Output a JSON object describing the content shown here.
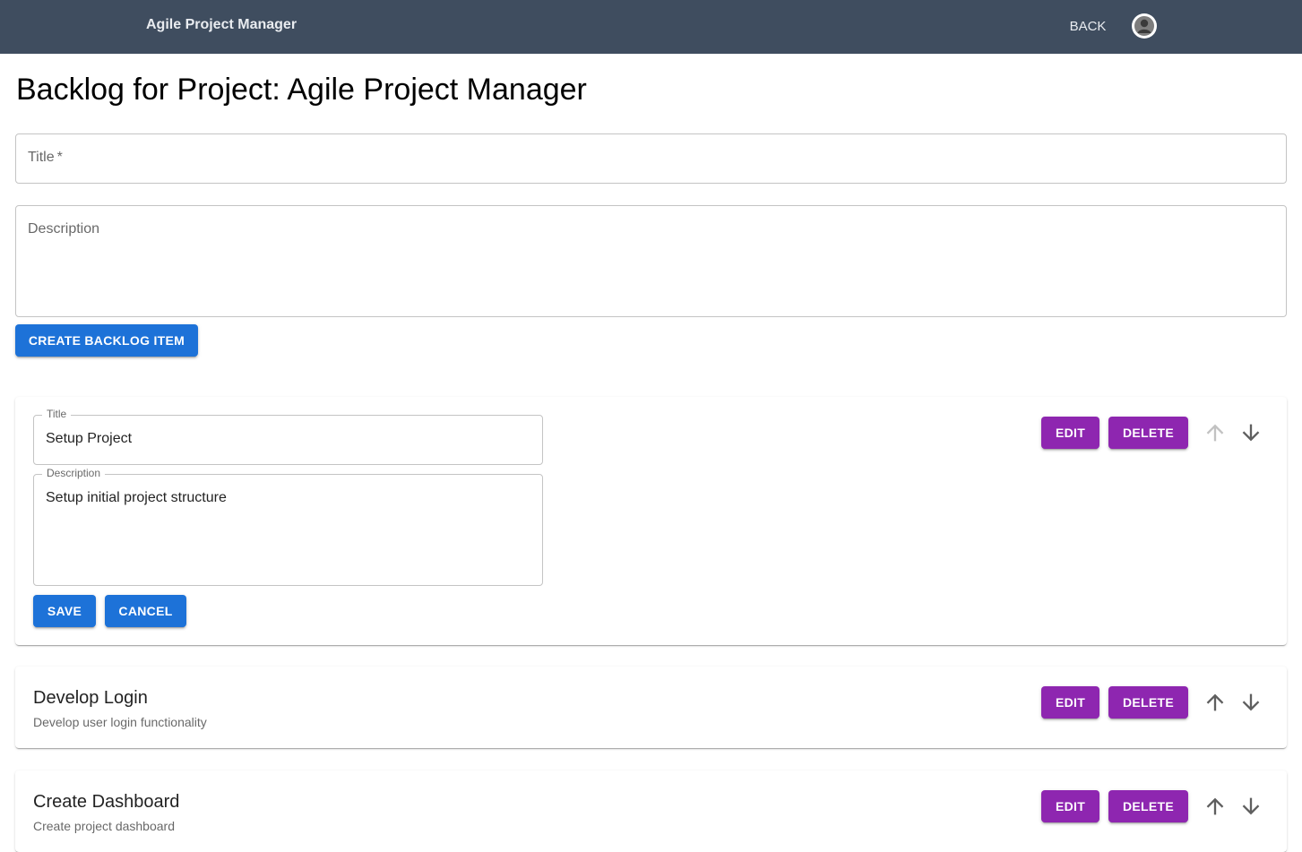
{
  "appbar": {
    "title": "Agile Project Manager",
    "back_label": "BACK"
  },
  "page": {
    "heading": "Backlog for Project: Agile Project Manager"
  },
  "create_form": {
    "title_placeholder": "Title",
    "title_required_mark": "*",
    "description_placeholder": "Description",
    "submit_label": "CREATE BACKLOG ITEM"
  },
  "items": [
    {
      "mode": "editing",
      "title_label": "Title",
      "title_value": "Setup Project",
      "description_label": "Description",
      "description_value": "Setup initial project structure",
      "save_label": "SAVE",
      "cancel_label": "CANCEL",
      "edit_label": "EDIT",
      "delete_label": "DELETE",
      "move_up_enabled": false,
      "move_down_enabled": true
    },
    {
      "mode": "view",
      "title": "Develop Login",
      "description": "Develop user login functionality",
      "edit_label": "EDIT",
      "delete_label": "DELETE",
      "move_up_enabled": true,
      "move_down_enabled": true
    },
    {
      "mode": "view",
      "title": "Create Dashboard",
      "description": "Create project dashboard",
      "edit_label": "EDIT",
      "delete_label": "DELETE",
      "move_up_enabled": true,
      "move_down_enabled": true
    }
  ],
  "colors": {
    "appbar": "#3f4d5f",
    "primary": "#1d72d8",
    "secondary": "#8e26b0",
    "arrow_enabled": "#5f5f5f",
    "arrow_disabled": "#c2c2c2"
  },
  "icons": {
    "avatar": "user-avatar-icon",
    "move_up": "arrow-up-icon",
    "move_down": "arrow-down-icon"
  }
}
